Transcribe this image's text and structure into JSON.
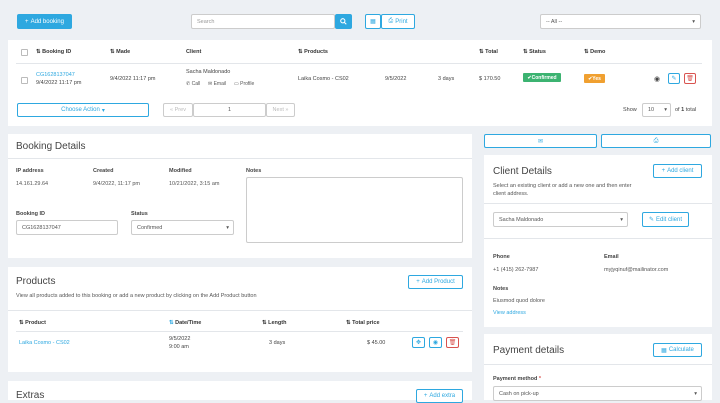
{
  "toolbar": {
    "add_booking": "Add booking",
    "search_placeholder": "Search",
    "print": "Print",
    "filter_value": "-- All --"
  },
  "table": {
    "headers": {
      "booking_id": "Booking ID",
      "made": "Made",
      "client": "Client",
      "products": "Products",
      "total": "Total",
      "status": "Status",
      "demo": "Demo"
    },
    "row": {
      "booking_id": "CG1628137047",
      "booking_date": "9/4/2022 11:17 pm",
      "made": "9/4/2022 11:17 pm",
      "client_name": "Sacha Maldonado",
      "call": "Call",
      "email": "Email",
      "profile": "Profile",
      "product": "Laika Cosmo - CS02",
      "date": "9/5/2022",
      "duration": "3 days",
      "total": "$ 170.50",
      "status": "Confirmed",
      "demo": "Yes"
    }
  },
  "pager": {
    "choose_action": "Choose Action",
    "prev": "« Prev",
    "page": "1",
    "next": "Next »",
    "show": "Show",
    "per_page": "10",
    "of": "of",
    "pages": "1",
    "total": "total"
  },
  "booking_details": {
    "title": "Booking Details",
    "ip_label": "IP address",
    "ip": "14.161.29.64",
    "created_label": "Created",
    "created": "9/4/2022, 11:17 pm",
    "modified_label": "Modified",
    "modified": "10/21/2022, 3:15 am",
    "notes_label": "Notes",
    "booking_id_label": "Booking ID",
    "booking_id": "CG1628137047",
    "status_label": "Status",
    "status": "Confirmed"
  },
  "products": {
    "title": "Products",
    "add": "Add Product",
    "desc": "View all products added to this booking or add a new product by clicking on the Add Product button",
    "headers": {
      "product": "Product",
      "datetime": "Date/Time",
      "length": "Length",
      "total": "Total price"
    },
    "row": {
      "name": "Laika Cosmo - CS02",
      "date": "9/5/2022",
      "time": "9:00 am",
      "length": "3 days",
      "price": "$ 45.00"
    }
  },
  "extras": {
    "title": "Extras",
    "add": "Add extra"
  },
  "client_details": {
    "title": "Client Details",
    "add": "Add client",
    "desc": "Select an existing client or add a new one and then enter client address.",
    "selected": "Sacha Maldonado",
    "edit": "Edit client",
    "phone_label": "Phone",
    "phone": "+1 (415) 262-7987",
    "email_label": "Email",
    "email": "myjyqinuf@mailinator.com",
    "notes_label": "Notes",
    "notes": "Eiusmod quod dolore",
    "view_address": "View address"
  },
  "payment": {
    "title": "Payment details",
    "calculate": "Calculate",
    "method_label": "Payment method",
    "method": "Cash on pick-up"
  },
  "colors": {
    "accent": "#2ea8e0",
    "confirmed": "#3cb371",
    "demo": "#f0a030",
    "danger": "#d9534f"
  }
}
